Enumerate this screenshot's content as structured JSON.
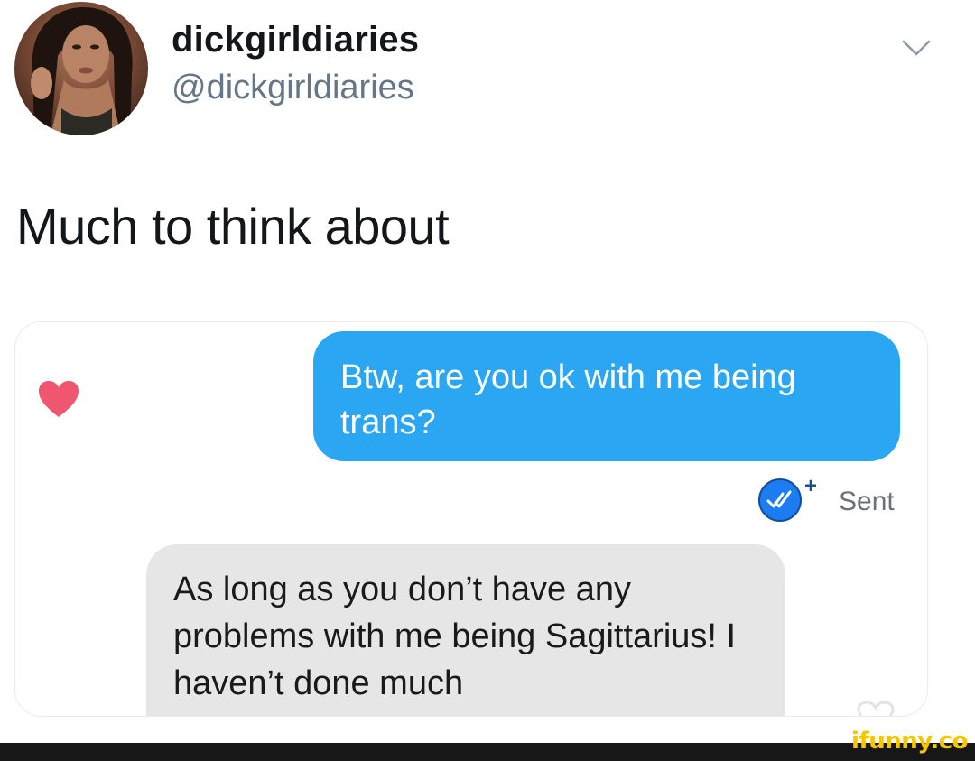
{
  "tweet": {
    "display_name": "dickgirldiaries",
    "handle": "@dickgirldiaries",
    "text": "Much to think about",
    "avatar_icon": "profile-photo",
    "menu_icon": "chevron-down-icon"
  },
  "chat": {
    "outgoing_message": "Btw, are you ok with me being trans?",
    "status": "Sent",
    "status_badge": "+",
    "incoming_message": "As long as you don’t have any problems with me being Sagittarius! I haven’t done much",
    "like_icon": "heart-icon"
  },
  "watermark": {
    "text": "ifunny.co"
  },
  "colors": {
    "outgoing_bubble": "#2aa6f2",
    "incoming_bubble": "#e6e6e6",
    "heart": "#f0566f",
    "read_receipt": "#1d7cf2",
    "watermark": "#f7c600"
  }
}
